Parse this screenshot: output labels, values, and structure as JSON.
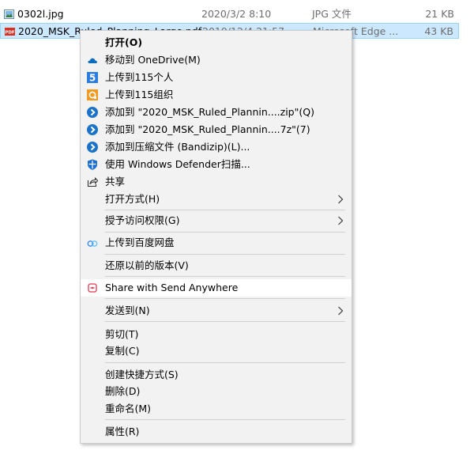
{
  "files": [
    {
      "name": "0302l.jpg",
      "date": "2020/3/2 8:10",
      "type": "JPG 文件",
      "size": "21 KB",
      "icon": "image-file-icon"
    },
    {
      "name": "2020_MSK_Ruled_Planning_Large.pdf",
      "date": "2019/12/4 21:57",
      "type": "Microsoft Edge ...",
      "size": "43 KB",
      "icon": "pdf-file-icon"
    }
  ],
  "menu": {
    "open": "打开(O)",
    "onedrive": "移动到 OneDrive(M)",
    "upload115_personal": "上传到115个人",
    "upload115_org": "上传到115组织",
    "bandizip_zip": "添加到 \"2020_MSK_Ruled_Plannin....zip\"(Q)",
    "bandizip_7z": "添加到 \"2020_MSK_Ruled_Plannin....7z\"(7)",
    "bandizip_archive": "添加到压缩文件 (Bandizip)(L)...",
    "defender": "使用 Windows Defender扫描...",
    "share": "共享",
    "open_with": "打开方式(H)",
    "grant_access": "授予访问权限(G)",
    "baidu": "上传到百度网盘",
    "restore": "还原以前的版本(V)",
    "send_anywhere": "Share with Send Anywhere",
    "send_to": "发送到(N)",
    "cut": "剪切(T)",
    "copy": "复制(C)",
    "shortcut": "创建快捷方式(S)",
    "delete": "删除(D)",
    "rename": "重命名(M)",
    "properties": "属性(R)"
  },
  "colors": {
    "selection": "#cce8ff",
    "menu_bg": "#f2f2f2",
    "hover_bg": "#ffffff",
    "onedrive": "#0f6cbd",
    "bandizip": "#1a73c9",
    "icon115_blue": "#2a7de1",
    "icon115_orange": "#f29a1f",
    "send_anywhere": "#e8344e"
  }
}
